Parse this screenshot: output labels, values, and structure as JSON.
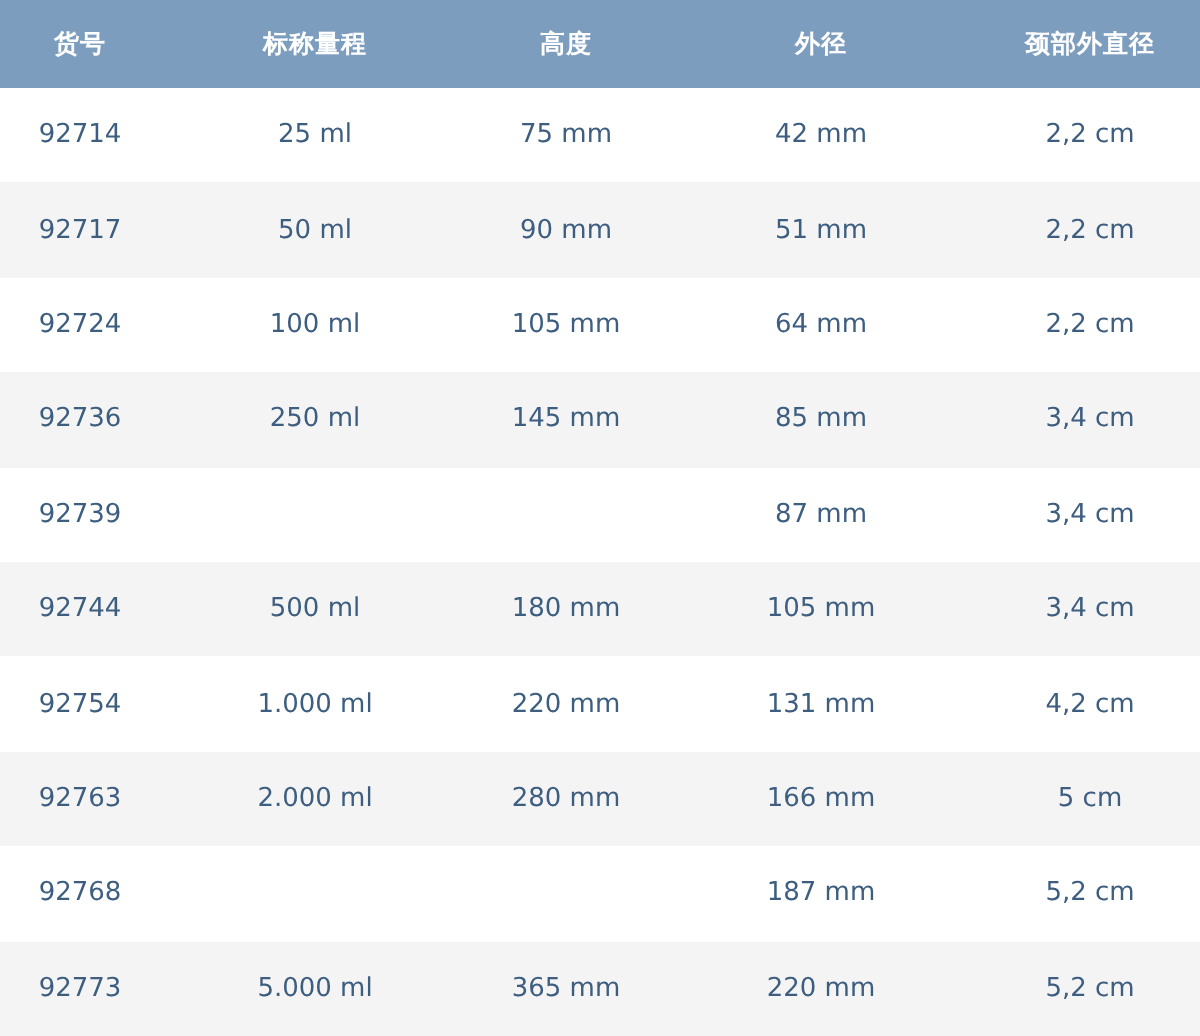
{
  "table": {
    "columns": [
      "货号",
      "标称量程",
      "高度",
      "外径",
      "颈部外直径"
    ],
    "rows": [
      {
        "item_no": "92714",
        "capacity": "25 ml",
        "height": "75 mm",
        "outer_diameter": "42 mm",
        "neck_diameter": "2,2 cm"
      },
      {
        "item_no": "92717",
        "capacity": "50 ml",
        "height": "90 mm",
        "outer_diameter": "51 mm",
        "neck_diameter": "2,2 cm"
      },
      {
        "item_no": "92724",
        "capacity": "100 ml",
        "height": "105 mm",
        "outer_diameter": "64 mm",
        "neck_diameter": "2,2 cm"
      },
      {
        "item_no": "92736",
        "capacity": "250 ml",
        "height": "145 mm",
        "outer_diameter": "85 mm",
        "neck_diameter": "3,4 cm"
      },
      {
        "item_no": "92739",
        "outer_diameter": "87 mm",
        "neck_diameter": "3,4 cm"
      },
      {
        "item_no": "92744",
        "capacity": "500 ml",
        "height": "180 mm",
        "outer_diameter": "105 mm",
        "neck_diameter": "3,4 cm"
      },
      {
        "item_no": "92754",
        "capacity": "1.000 ml",
        "height": "220 mm",
        "outer_diameter": "131 mm",
        "neck_diameter": "4,2 cm"
      },
      {
        "item_no": "92763",
        "capacity": "2.000 ml",
        "height": "280 mm",
        "outer_diameter": "166 mm",
        "neck_diameter": "5 cm"
      },
      {
        "item_no": "92768",
        "outer_diameter": "187 mm",
        "neck_diameter": "5,2 cm"
      },
      {
        "item_no": "92773",
        "capacity": "5.000 ml",
        "height": "365 mm",
        "outer_diameter": "220 mm",
        "neck_diameter": "5,2 cm"
      }
    ]
  }
}
